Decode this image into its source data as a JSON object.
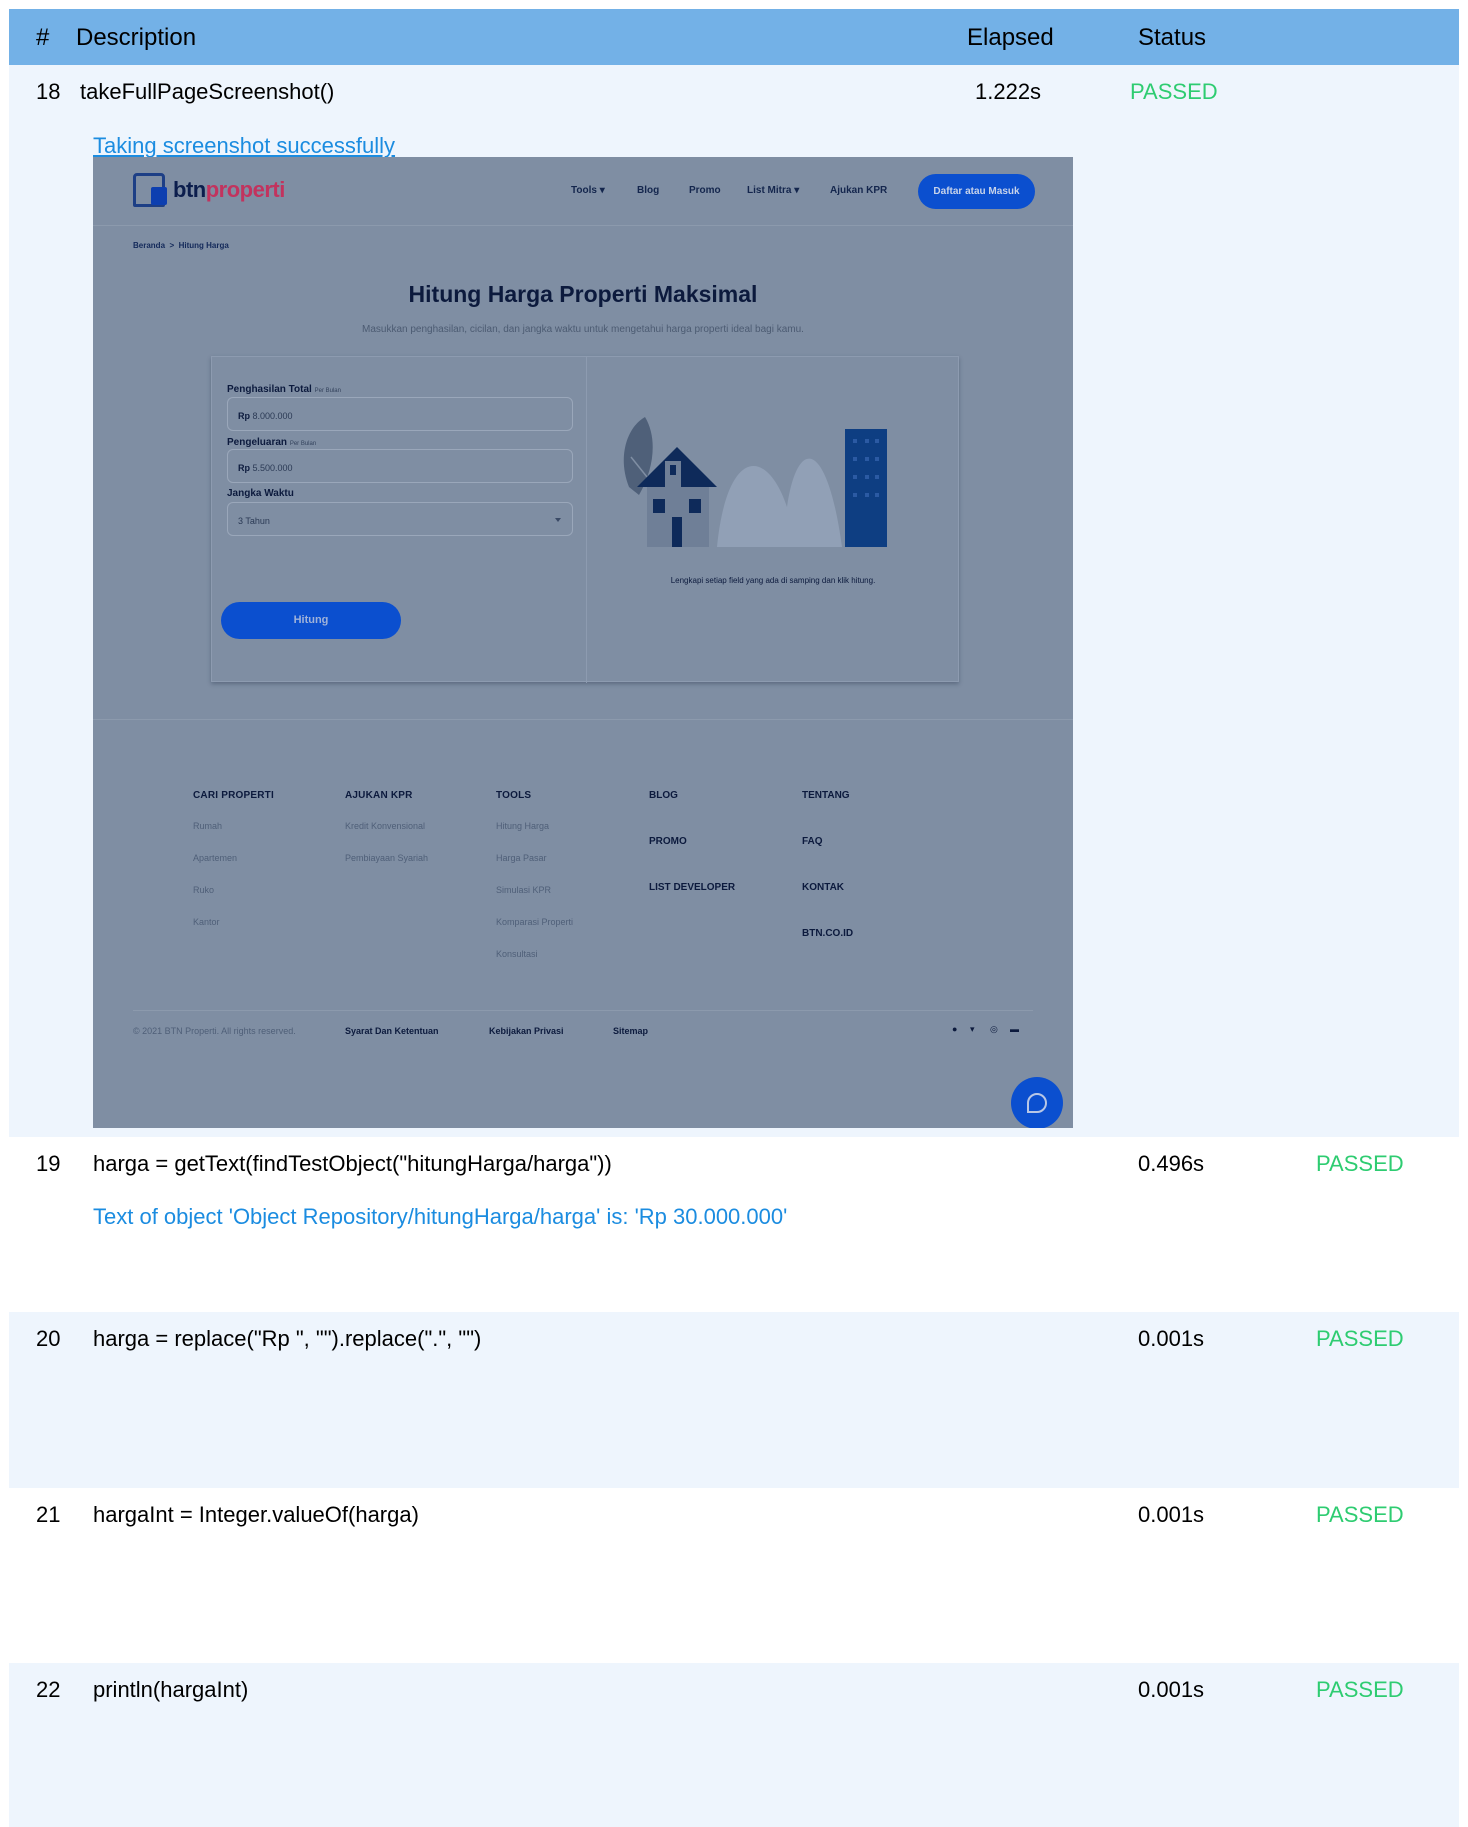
{
  "table": {
    "headers": {
      "num": "#",
      "description": "Description",
      "elapsed": "Elapsed",
      "status": "Status"
    },
    "rows": [
      {
        "num": "18",
        "description": "takeFullPageScreenshot()",
        "elapsed": "1.222s",
        "status": "PASSED",
        "message": "Taking screenshot successfully"
      },
      {
        "num": "19",
        "description": "harga = getText(findTestObject(\"hitungHarga/harga\"))",
        "elapsed": "0.496s",
        "status": "PASSED",
        "message": "Text of object 'Object Repository/hitungHarga/harga' is: 'Rp 30.000.000'"
      },
      {
        "num": "20",
        "description": "harga = replace(\"Rp \", \"\").replace(\".\", \"\")",
        "elapsed": "0.001s",
        "status": "PASSED"
      },
      {
        "num": "21",
        "description": "hargaInt = Integer.valueOf(harga)",
        "elapsed": "0.001s",
        "status": "PASSED"
      },
      {
        "num": "22",
        "description": "println(hargaInt)",
        "elapsed": "0.001s",
        "status": "PASSED"
      }
    ]
  },
  "screenshot": {
    "logo": {
      "prefix": "btn",
      "suffix": "properti"
    },
    "nav": {
      "tools": "Tools ▾",
      "blog": "Blog",
      "promo": "Promo",
      "list_mitra": "List Mitra ▾",
      "ajukan_kpr": "Ajukan KPR",
      "cta": "Daftar atau Masuk"
    },
    "breadcrumb": {
      "home": "Beranda",
      "sep": ">",
      "current": "Hitung Harga"
    },
    "title": "Hitung Harga Properti Maksimal",
    "subtitle": "Masukkan penghasilan, cicilan, dan jangka waktu untuk mengetahui harga properti ideal bagi kamu.",
    "form": {
      "income_label": "Penghasilan Total",
      "income_unit": "Per Bulan",
      "income_currency": "Rp",
      "income_value": "8.000.000",
      "expense_label": "Pengeluaran",
      "expense_unit": "Per Bulan",
      "expense_currency": "Rp",
      "expense_value": "5.500.000",
      "term_label": "Jangka Waktu",
      "term_value": "3 Tahun",
      "submit": "Hitung"
    },
    "illustration_caption": "Lengkapi setiap field yang ada di samping dan klik hitung.",
    "footer": {
      "col1": {
        "head": "CARI PROPERTI",
        "items": [
          "Rumah",
          "Apartemen",
          "Ruko",
          "Kantor"
        ]
      },
      "col2": {
        "head": "AJUKAN KPR",
        "items": [
          "Kredit Konvensional",
          "Pembiayaan Syariah"
        ]
      },
      "col3": {
        "head": "TOOLS",
        "items": [
          "Hitung Harga",
          "Harga Pasar",
          "Simulasi KPR",
          "Komparasi Properti",
          "Konsultasi"
        ]
      },
      "col4": [
        "BLOG",
        "PROMO",
        "LIST DEVELOPER"
      ],
      "col5": [
        "TENTANG",
        "FAQ",
        "KONTAK",
        "BTN.CO.ID"
      ],
      "copyright": "© 2021 BTN Properti. All rights reserved.",
      "links": {
        "terms": "Syarat Dan Ketentuan",
        "privacy": "Kebijakan Privasi",
        "sitemap": "Sitemap"
      }
    },
    "colors": {
      "overlay": "#7f8ea3",
      "primary": "#0b4fcf",
      "dark": "#0c1a3d"
    }
  },
  "colors": {
    "header_bg": "#73b1e7",
    "alt_row": "#eef5fd",
    "passed": "#2ecc71",
    "message": "#1b8ce0"
  }
}
